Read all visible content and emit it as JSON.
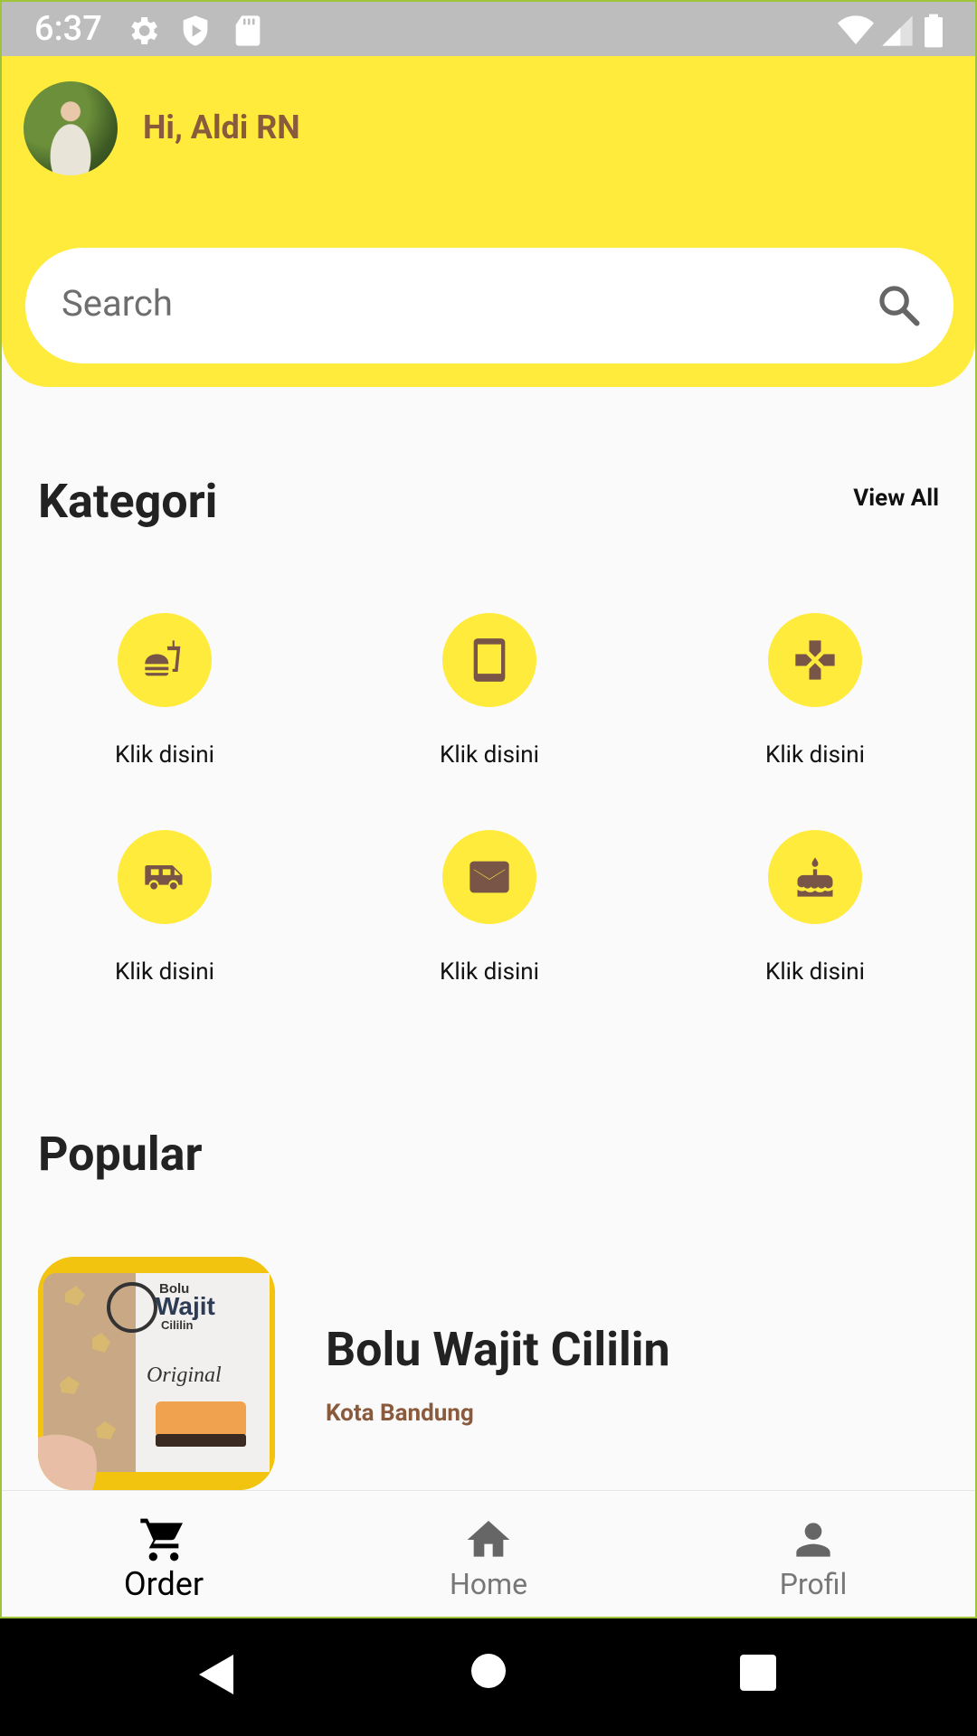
{
  "status_bar": {
    "time": "6:37"
  },
  "header": {
    "greeting": "Hi, Aldi RN"
  },
  "search": {
    "placeholder": "Search"
  },
  "kategori": {
    "title": "Kategori",
    "view_all": "View All",
    "items": [
      {
        "label": "Klik disini",
        "icon": "fastfood-icon"
      },
      {
        "label": "Klik disini",
        "icon": "tablet-icon"
      },
      {
        "label": "Klik disini",
        "icon": "gamepad-icon"
      },
      {
        "label": "Klik disini",
        "icon": "van-icon"
      },
      {
        "label": "Klik disini",
        "icon": "mail-icon"
      },
      {
        "label": "Klik disini",
        "icon": "cake-icon"
      }
    ]
  },
  "popular": {
    "title": "Popular",
    "items": [
      {
        "name": "Bolu Wajit Cililin",
        "city": "Kota Bandung"
      }
    ]
  },
  "bottom_nav": {
    "items": [
      {
        "label": "Order",
        "icon": "cart-icon",
        "active": true
      },
      {
        "label": "Home",
        "icon": "home-icon",
        "active": false
      },
      {
        "label": "Profil",
        "icon": "person-icon",
        "active": false
      }
    ]
  },
  "colors": {
    "accent_yellow": "#FFEB3B",
    "brown": "#8A5A3C",
    "icon_brown": "#795548"
  }
}
